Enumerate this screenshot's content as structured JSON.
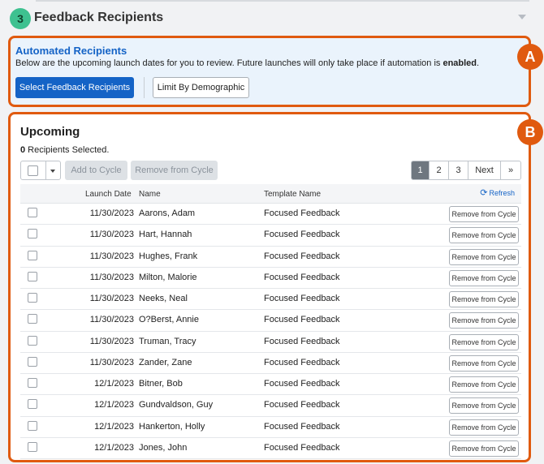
{
  "section": {
    "step": "3",
    "title": "Feedback Recipients"
  },
  "automated": {
    "title": "Automated Recipients",
    "desc_before": "Below are the upcoming launch dates for you to review. Future launches will only take place if automation is ",
    "desc_bold": "enabled",
    "desc_after": ".",
    "select_button": "Select Feedback Recipients",
    "limit_button": "Limit By Demographic"
  },
  "markers": {
    "a": "A",
    "b": "B"
  },
  "upcoming": {
    "title": "Upcoming",
    "selected_count": "0",
    "selected_suffix": " Recipients Selected.",
    "add_button": "Add to Cycle",
    "remove_button": "Remove from Cycle",
    "pager": [
      "1",
      "2",
      "3",
      "Next",
      "»"
    ],
    "pager_active": "1",
    "columns": {
      "date": "Launch Date",
      "name": "Name",
      "template": "Template Name"
    },
    "refresh": "Refresh",
    "row_action": "Remove from Cycle",
    "rows": [
      {
        "date": "11/30/2023",
        "name": "Aarons, Adam",
        "template": "Focused Feedback"
      },
      {
        "date": "11/30/2023",
        "name": "Hart, Hannah",
        "template": "Focused Feedback"
      },
      {
        "date": "11/30/2023",
        "name": "Hughes, Frank",
        "template": "Focused Feedback"
      },
      {
        "date": "11/30/2023",
        "name": "Milton, Malorie",
        "template": "Focused Feedback"
      },
      {
        "date": "11/30/2023",
        "name": "Neeks, Neal",
        "template": "Focused Feedback"
      },
      {
        "date": "11/30/2023",
        "name": "O?Berst, Annie",
        "template": "Focused Feedback"
      },
      {
        "date": "11/30/2023",
        "name": "Truman, Tracy",
        "template": "Focused Feedback"
      },
      {
        "date": "11/30/2023",
        "name": "Zander, Zane",
        "template": "Focused Feedback"
      },
      {
        "date": "12/1/2023",
        "name": "Bitner, Bob",
        "template": "Focused Feedback"
      },
      {
        "date": "12/1/2023",
        "name": "Gundvaldson, Guy",
        "template": "Focused Feedback"
      },
      {
        "date": "12/1/2023",
        "name": "Hankerton, Holly",
        "template": "Focused Feedback"
      },
      {
        "date": "12/1/2023",
        "name": "Jones, John",
        "template": "Focused Feedback"
      }
    ]
  },
  "colors": {
    "accent": "#1463c6",
    "callout": "#e05a0f",
    "step_badge": "#3ec190"
  }
}
